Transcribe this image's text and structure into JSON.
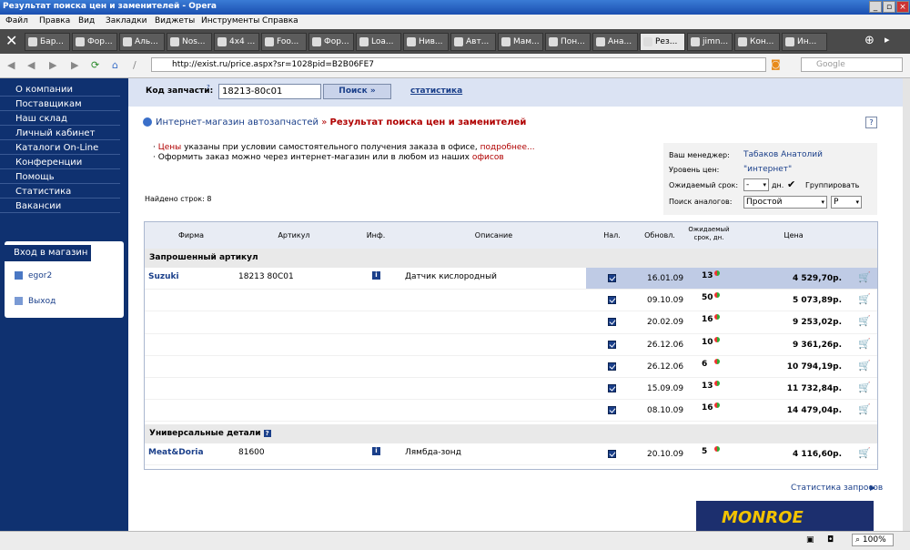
{
  "window": {
    "title": "Результат поиска цен и заменителей - Opera",
    "controls": [
      "_",
      "▫",
      "×"
    ]
  },
  "menu": [
    "Файл",
    "Правка",
    "Вид",
    "Закладки",
    "Виджеты",
    "Инструменты",
    "Справка"
  ],
  "tabs": [
    "Бар...",
    "Фор...",
    "Аль...",
    "Nos...",
    "4x4 ...",
    "Foo...",
    "Фор...",
    "Loa...",
    "Нив...",
    "Авт...",
    "Мам...",
    "Пон...",
    "Ана...",
    "Рез...",
    "jimn...",
    "Кон...",
    "Ин..."
  ],
  "address": {
    "url": "http://exist.ru/price.aspx?sr=1028pid=B2B06FE7",
    "search_placeholder": "Google"
  },
  "sidebar": {
    "items": [
      "О компании",
      "Поставщикам",
      "Наш склад",
      "Личный кабинет",
      "Каталоги On-Line",
      "Конференции",
      "Помощь",
      "Статистика",
      "Вакансии"
    ],
    "login_title": "Вход в магазин",
    "user": "egor2",
    "logout": "Выход"
  },
  "search": {
    "label": "Код запчасти:",
    "help": "?",
    "value": "18213-80c01",
    "button": "Поиск »",
    "stats_link": "статистика"
  },
  "breadcrumb": {
    "root": "Интернет-магазин автозапчастей",
    "sep": "»",
    "current": "Результат поиска цен и заменителей"
  },
  "notes": {
    "n1_a": "Цены",
    "n1_b": "указаны при условии самостоятельного получения заказа в офисе,",
    "n1_link": "подробнее...",
    "n2_a": "Оформить заказ можно через интернет-магазин или в любом из наших",
    "n2_link": "офисов"
  },
  "manager": {
    "label_manager": "Ваш менеджер:",
    "manager_name": "Табаков Анатолий",
    "label_level": "Уровень цен:",
    "level": "\"интернет\"",
    "label_term": "Ожидаемый срок:",
    "term_value": "-",
    "term_unit": "дн.",
    "group_label": "Группировать",
    "label_analog": "Поиск аналогов:",
    "analog_value": "Простой",
    "analog_second": "Р"
  },
  "found": "Найдено строк: 8",
  "table": {
    "headers": [
      "Фирма",
      "Артикул",
      "Инф.",
      "Описание",
      "Нал.",
      "Обновл.",
      "Ожидаемый срок, дн.",
      "Цена"
    ],
    "help": "?",
    "section1": "Запрошенный артикул",
    "section2": "Универсальные детали",
    "rows1": [
      {
        "firm": "Suzuki",
        "article": "18213 80C01",
        "info": "i",
        "desc": "Датчик кислородный",
        "date": "16.01.09",
        "term": "13",
        "price": "4 529,70р."
      },
      {
        "firm": "",
        "article": "",
        "info": "",
        "desc": "",
        "date": "09.10.09",
        "term": "50",
        "price": "5 073,89р."
      },
      {
        "firm": "",
        "article": "",
        "info": "",
        "desc": "",
        "date": "20.02.09",
        "term": "16",
        "price": "9 253,02р."
      },
      {
        "firm": "",
        "article": "",
        "info": "",
        "desc": "",
        "date": "26.12.06",
        "term": "10",
        "price": "9 361,26р."
      },
      {
        "firm": "",
        "article": "",
        "info": "",
        "desc": "",
        "date": "26.12.06",
        "term": "6",
        "price": "10 794,19р."
      },
      {
        "firm": "",
        "article": "",
        "info": "",
        "desc": "",
        "date": "15.09.09",
        "term": "13",
        "price": "11 732,84р."
      },
      {
        "firm": "",
        "article": "",
        "info": "",
        "desc": "",
        "date": "08.10.09",
        "term": "16",
        "price": "14 479,04р."
      }
    ],
    "rows2": [
      {
        "firm": "Meat&Doria",
        "article": "81600",
        "info": "i",
        "desc": "Лямбда-зонд",
        "date": "20.10.09",
        "term": "5",
        "price": "4 116,60р."
      }
    ]
  },
  "stats_requests": "Статистика запросов",
  "ad_text": "MONROE",
  "status": {
    "zoom": "100%"
  }
}
